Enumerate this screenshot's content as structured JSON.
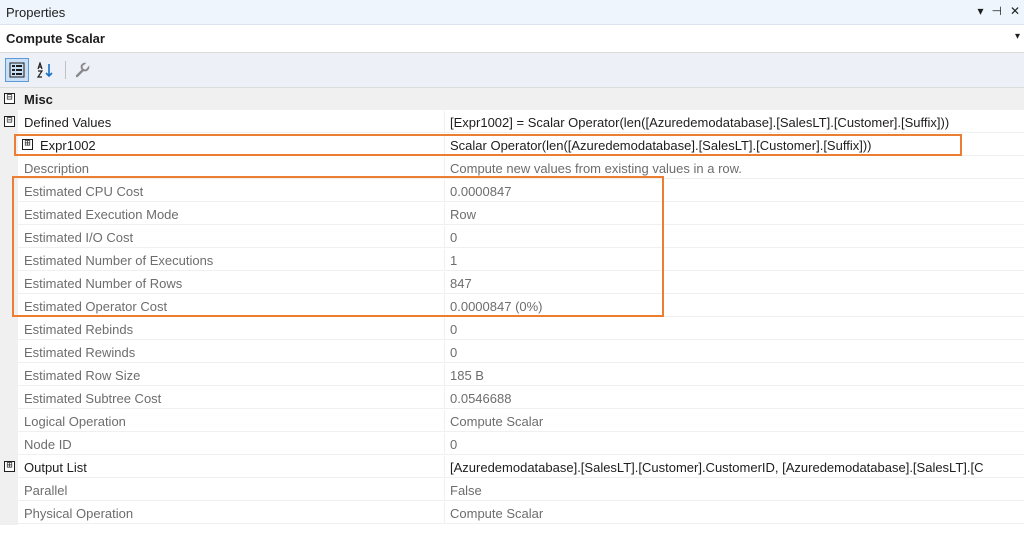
{
  "window": {
    "title": "Properties",
    "controls": {
      "dropdown": "▾",
      "pin": "⊣",
      "close": "✕"
    }
  },
  "object_selector": {
    "value": "Compute Scalar",
    "dropdown": "▾"
  },
  "toolbar": {
    "categorized": "categorized-icon",
    "alphabetical": "alphabetical-icon",
    "property_pages": "wrench-icon"
  },
  "colors": {
    "highlight": "#ed7d31",
    "category_bg": "#f0f0f0",
    "dim_text": "#6d6d6d"
  },
  "rows": [
    {
      "kind": "cat",
      "toggle": "⊟",
      "name": "Misc",
      "value": ""
    },
    {
      "kind": "exp",
      "toggle": "⊟",
      "name": "Defined Values",
      "value": "[Expr1002] = Scalar Operator(len([Azuredemodatabase].[SalesLT].[Customer].[Suffix]))"
    },
    {
      "kind": "sub",
      "toggle": "⊞",
      "name": "Expr1002",
      "value": "Scalar Operator(len([Azuredemodatabase].[SalesLT].[Customer].[Suffix]))"
    },
    {
      "kind": "dim",
      "name": "Description",
      "value": "Compute new values from existing values in a row."
    },
    {
      "kind": "dim",
      "name": "Estimated CPU Cost",
      "value": "0.0000847"
    },
    {
      "kind": "dim",
      "name": "Estimated Execution Mode",
      "value": "Row"
    },
    {
      "kind": "dim",
      "name": "Estimated I/O Cost",
      "value": "0"
    },
    {
      "kind": "dim",
      "name": "Estimated Number of Executions",
      "value": "1"
    },
    {
      "kind": "dim",
      "name": "Estimated Number of Rows",
      "value": "847"
    },
    {
      "kind": "dim",
      "name": "Estimated Operator Cost",
      "value": "0.0000847 (0%)"
    },
    {
      "kind": "dim",
      "name": "Estimated Rebinds",
      "value": "0"
    },
    {
      "kind": "dim",
      "name": "Estimated Rewinds",
      "value": "0"
    },
    {
      "kind": "dim",
      "name": "Estimated Row Size",
      "value": "185 B"
    },
    {
      "kind": "dim",
      "name": "Estimated Subtree Cost",
      "value": "0.0546688"
    },
    {
      "kind": "dim",
      "name": "Logical Operation",
      "value": "Compute Scalar"
    },
    {
      "kind": "dim",
      "name": "Node ID",
      "value": "0"
    },
    {
      "kind": "exp",
      "toggle": "⊞",
      "name": "Output List",
      "value": "[Azuredemodatabase].[SalesLT].[Customer].CustomerID, [Azuredemodatabase].[SalesLT].[C"
    },
    {
      "kind": "dim",
      "name": "Parallel",
      "value": "False"
    },
    {
      "kind": "dim",
      "name": "Physical Operation",
      "value": "Compute Scalar"
    }
  ]
}
